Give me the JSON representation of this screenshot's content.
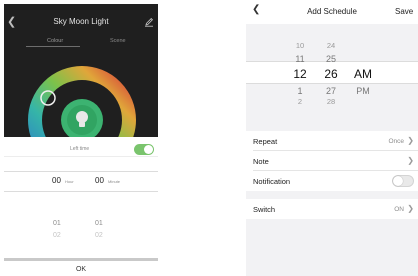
{
  "left": {
    "title": "Sky Moon Light",
    "tabs": [
      {
        "label": "Colour",
        "active": true
      },
      {
        "label": "Scene",
        "active": false
      }
    ],
    "left_time": {
      "label": "Left time",
      "on": true
    },
    "picker": {
      "hour": {
        "value": "00",
        "unit": "Hour",
        "next": [
          "01",
          "02"
        ]
      },
      "minute": {
        "value": "00",
        "unit": "Minute",
        "next": [
          "01",
          "02"
        ]
      }
    },
    "ok_label": "OK",
    "colors": {
      "toggle_on": "#7ac46d",
      "bulb": "#3cb371",
      "background": "#1f1f1f"
    }
  },
  "right": {
    "header": {
      "back_icon": "chevron-left-icon",
      "title": "Add Schedule",
      "save_label": "Save"
    },
    "time_picker": {
      "hours_above": [
        "10",
        "11"
      ],
      "hour": "12",
      "hours_below": [
        "1",
        "2"
      ],
      "minutes_above": [
        "24",
        "25"
      ],
      "minute": "26",
      "minutes_below": [
        "27",
        "28"
      ],
      "ampm": "AM",
      "ampm_below": "PM"
    },
    "rows": {
      "repeat": {
        "label": "Repeat",
        "value": "Once"
      },
      "note": {
        "label": "Note"
      },
      "notification": {
        "label": "Notification",
        "on": false
      },
      "switch": {
        "label": "Switch",
        "value": "ON"
      }
    }
  }
}
